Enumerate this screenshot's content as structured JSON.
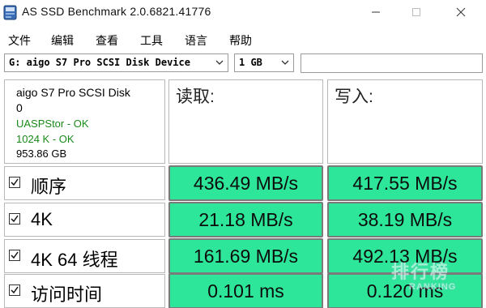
{
  "window": {
    "title": "AS SSD Benchmark 2.0.6821.41776"
  },
  "icons": {
    "app": "drive-benchmark-icon",
    "minimize": "minimize-icon",
    "maximize": "maximize-icon",
    "close": "close-icon",
    "dropdown": "chevron-down-icon",
    "checkbox": "checkbox-checked-icon"
  },
  "menu": {
    "items": [
      {
        "label": "文件"
      },
      {
        "label": "编辑"
      },
      {
        "label": "查看"
      },
      {
        "label": "工具"
      },
      {
        "label": "语言"
      },
      {
        "label": "帮助"
      }
    ]
  },
  "toolbar": {
    "drive_value": "G: aigo S7 Pro SCSI Disk Device",
    "size_value": "1 GB",
    "search_value": ""
  },
  "info": {
    "model": "aigo S7 Pro SCSI Disk",
    "index": "0",
    "driver_status": "UASPStor - OK",
    "alignment_status": "1024 K - OK",
    "capacity": "953.86 GB"
  },
  "columns": {
    "read": "读取:",
    "write": "写入:"
  },
  "rows": [
    {
      "label": "顺序",
      "read": "436.49 MB/s",
      "write": "417.55 MB/s",
      "checked": true
    },
    {
      "label": "4K",
      "read": "21.18 MB/s",
      "write": "38.19 MB/s",
      "checked": true
    },
    {
      "label": "4K 64 线程",
      "read": "161.69 MB/s",
      "write": "492.13 MB/s",
      "checked": true
    },
    {
      "label": "访问时间",
      "read": "0.101 ms",
      "write": "0.120 ms",
      "checked": true
    }
  ],
  "colors": {
    "result_fill": "#2ee69a",
    "ok_text": "#1a8a1a"
  },
  "watermark": {
    "main": "排行榜",
    "sub": "RANKING"
  }
}
